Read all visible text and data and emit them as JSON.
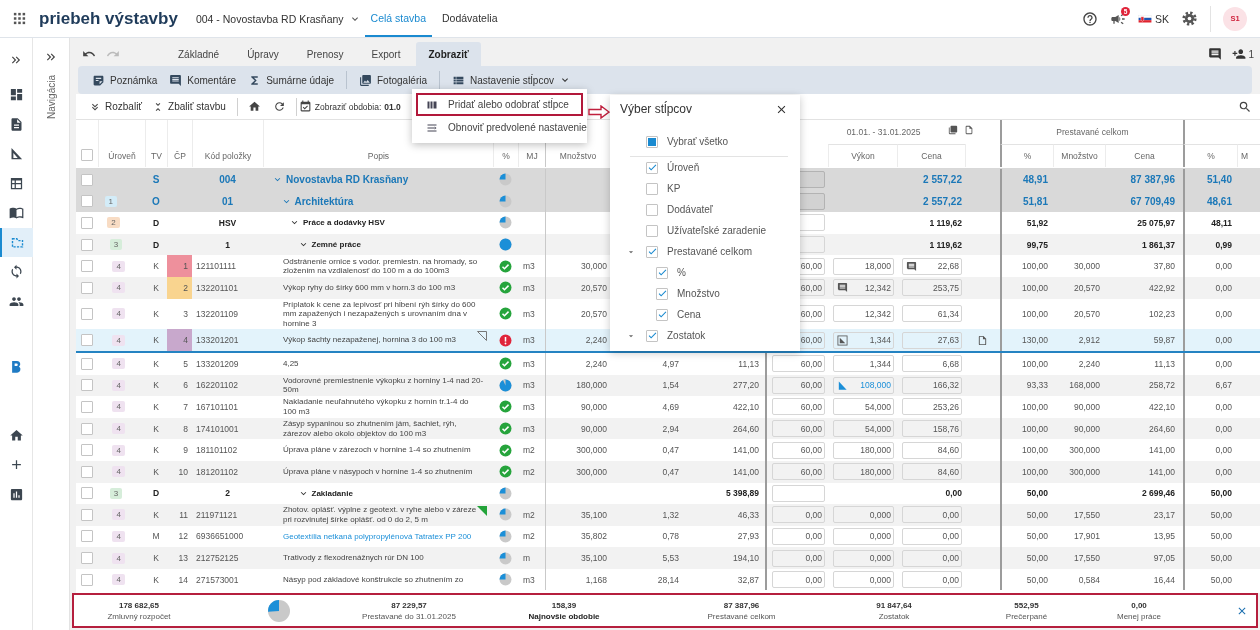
{
  "header": {
    "title": "priebeh výstavby",
    "project": "004 - Novostavba RD Krasňany",
    "tabs": [
      {
        "label": "Celá stavba",
        "selected": true
      },
      {
        "label": "Dodávatelia",
        "selected": false
      }
    ],
    "notifications": "5",
    "language": "SK",
    "avatar": "S1"
  },
  "rail": [
    {
      "selected": false
    },
    {
      "selected": false
    },
    {
      "selected": false
    },
    {
      "selected": false
    },
    {
      "selected": false
    },
    {
      "selected": true
    },
    {
      "selected": false
    },
    {
      "selected": false
    },
    {
      "selected": false
    },
    {
      "selected": false
    },
    {
      "selected": false
    },
    {
      "selected": false
    }
  ],
  "navigation": {
    "label": "Navigácia"
  },
  "toolbar": {
    "undo_enabled": true,
    "redo_enabled": false,
    "tabs": [
      {
        "label": "Základné",
        "selected": false
      },
      {
        "label": "Úpravy",
        "selected": false
      },
      {
        "label": "Prenosy",
        "selected": false
      },
      {
        "label": "Export",
        "selected": false
      },
      {
        "label": "Zobraziť",
        "selected": true
      }
    ],
    "online_users": "1"
  },
  "ribbon": {
    "groups": [
      [
        "Poznámka",
        "Komentáre",
        "Sumárne údaje"
      ],
      [
        "Fotogaléria"
      ]
    ],
    "columns_button": {
      "label": "Nastavenie stĺpcov",
      "expanded": true
    }
  },
  "columns_menu": {
    "items": [
      {
        "label": "Pridať alebo odobrať stĺpce",
        "highlighted": true
      },
      {
        "label": "Obnoviť predvolené nastavenie",
        "highlighted": false
      }
    ]
  },
  "actions": {
    "buttons": [
      "Rozbaliť",
      "Zbaliť stavbu"
    ],
    "period": "Zobraziť obdobia: **01.0**"
  },
  "column_picker": {
    "title": "Výber stĺpcov",
    "select_all": {
      "label": "Vybrať všetko",
      "checked": false,
      "indeterminate": true
    },
    "items": [
      {
        "label": "Úroveň",
        "checked": true
      },
      {
        "label": "KP",
        "checked": false
      },
      {
        "label": "Dodávateľ",
        "checked": false
      },
      {
        "label": "Užívateľské zaradenie",
        "checked": false
      },
      {
        "label": "Prestavané celkom",
        "checked": true,
        "expanded": true,
        "children": [
          {
            "label": "%",
            "checked": true
          },
          {
            "label": "Množstvo",
            "checked": true
          },
          {
            "label": "Cena",
            "checked": true
          }
        ]
      },
      {
        "label": "Zostatok",
        "checked": true,
        "expanded": true
      }
    ]
  },
  "table": {
    "header_checked": false,
    "period": "01.01. - 31.01.2025",
    "total_group": "Prestavané celkom",
    "headers": {
      "uroven": "Úroveň",
      "tv": "TV",
      "cp": "ČP",
      "code": "Kód položky",
      "desc": "Popis",
      "status": "%",
      "mj": "MJ",
      "qty": "Množstvo",
      "vykon": "Výkon",
      "cena": "Cena",
      "p_pct": "%",
      "p_qty": "Množstvo",
      "p_cena": "Cena",
      "z_pct": "%",
      "z_qty": "M"
    },
    "rows": [
      {
        "kind": "section",
        "selected": false,
        "checked": false,
        "tv": "S",
        "code": "004",
        "desc": "Novostavba RD Krasňany",
        "expanded": true,
        "status": {
          "kind": "pie",
          "level": 0.5
        },
        "cena": "2 557,22",
        "p_pct": "48,91",
        "p_cena": "87 387,96",
        "z_pct": "51,40",
        "children": [
          {
            "kind": "section",
            "selected": false,
            "checked": false,
            "uroven": {
              "text": "1",
              "color": "#d3ecf8"
            },
            "tv": "O",
            "code": "01",
            "desc": "Architektúra",
            "expanded": true,
            "status": {
              "kind": "pie",
              "level": 0.5
            },
            "cena": "2 557,22",
            "p_pct": "51,81",
            "p_cena": "67 709,49",
            "z_pct": "48,61",
            "children": [
              {
                "kind": "group",
                "selected": false,
                "checked": false,
                "uroven": {
                  "text": "2",
                  "color": "#f8dcc4"
                },
                "tv": "D",
                "code": "HSV",
                "desc": "Práce a dodávky HSV",
                "expanded": true,
                "status": {
                  "kind": "pie",
                  "level": 0.5
                },
                "cena": "1 119,62",
                "p_pct": "51,92",
                "p_cena": "25 075,97",
                "z_pct": "48,11",
                "children": [
                  {
                    "kind": "group",
                    "selected": false,
                    "checked": false,
                    "uroven": {
                      "text": "3",
                      "color": "#d6edda"
                    },
                    "tv": "D",
                    "code": "1",
                    "desc": "Zemné práce",
                    "expanded": true,
                    "status": {
                      "kind": "pie",
                      "level": 1
                    },
                    "cena": "1 119,62",
                    "p_pct": "99,75",
                    "p_cena": "1 861,37",
                    "z_pct": "0,99",
                    "children": [
                      {
                        "kind": "item",
                        "selected": false,
                        "checked": false,
                        "uroven": {
                          "text": "4",
                          "color": "#efe2f0"
                        },
                        "tv": "K",
                        "cp": {
                          "text": "1",
                          "color": "#ee909c"
                        },
                        "code": "121101111",
                        "desc": "Odstránenie ornice s vodor. premiestn. na hromady, so zložením na vzdialenosť do 100 m a do 100m3",
                        "status": {
                          "kind": "check"
                        },
                        "mj": "m3",
                        "qty": "30,000",
                        "pct": "60,00",
                        "vykon": "18,000",
                        "cena": "22,68",
                        "cena_icon": {
                          "kind": "comment"
                        },
                        "p_pct": "100,00",
                        "p_qty": "30,000",
                        "p_cena": "37,80",
                        "z_pct": "0,00"
                      },
                      {
                        "kind": "item",
                        "selected": false,
                        "checked": false,
                        "uroven": {
                          "text": "4",
                          "color": "#efe2f0"
                        },
                        "tv": "K",
                        "cp": {
                          "text": "2",
                          "color": "#f9d48f"
                        },
                        "code": "132201101",
                        "desc": "Výkop ryhy do šírky 600 mm v horn.3 do 100 m3",
                        "status": {
                          "kind": "check"
                        },
                        "mj": "m3",
                        "qty": "20,570",
                        "pct": "60,00",
                        "vykon": "12,342",
                        "vykon_icon": {
                          "kind": "comment",
                          "active": false
                        },
                        "cena": "253,75",
                        "p_pct": "100,00",
                        "p_qty": "20,570",
                        "p_cena": "422,92",
                        "z_pct": "0,00"
                      },
                      {
                        "kind": "item",
                        "selected": false,
                        "checked": false,
                        "uroven": {
                          "text": "4",
                          "color": "#efe2f0"
                        },
                        "tv": "K",
                        "cp": {
                          "text": "3"
                        },
                        "code": "132201109",
                        "desc": "Príplatok k cene za lepivosť pri hĺbení rýh šírky do 600 mm zapažených i nezapažených s urovnaním dna v hornine 3",
                        "status": {
                          "kind": "check"
                        },
                        "mj": "m3",
                        "qty": "20,570",
                        "pct": "60,00",
                        "vykon": "12,342",
                        "cena": "61,34",
                        "p_pct": "100,00",
                        "p_qty": "20,570",
                        "p_cena": "102,23",
                        "z_pct": "0,00"
                      },
                      {
                        "kind": "item",
                        "selected": true,
                        "checked": false,
                        "uroven": {
                          "text": "4",
                          "color": "#efe2f0"
                        },
                        "tv": "K",
                        "cp": {
                          "text": "4",
                          "color": "#c8a8cc"
                        },
                        "code": "133201201",
                        "desc": "Výkop šachty nezapaženej, hornina 3 do 100 m3",
                        "corner": {
                          "kind": "outline"
                        },
                        "status": {
                          "kind": "alert"
                        },
                        "mj": "m3",
                        "qty": "2,240",
                        "pct": "60,00",
                        "vykon": "1,344",
                        "vykon_icon": {
                          "kind": "sketch",
                          "active": false
                        },
                        "cena": "27,63",
                        "attachment": true,
                        "p_pct": "130,00",
                        "p_qty": "2,912",
                        "p_cena": "59,87",
                        "z_pct": "0,00"
                      },
                      {
                        "kind": "item",
                        "selected": false,
                        "checked": false,
                        "uroven": {
                          "text": "4",
                          "color": "#efe2f0"
                        },
                        "tv": "K",
                        "cp": {
                          "text": "5"
                        },
                        "code": "133201209",
                        "desc": "4,25",
                        "status": {
                          "kind": "check"
                        },
                        "mj": "m3",
                        "qty": "2,240",
                        "c9": "4,97",
                        "c10": "11,13",
                        "pct": "60,00",
                        "vykon": "1,344",
                        "cena": "6,68",
                        "p_pct": "100,00",
                        "p_qty": "2,240",
                        "p_cena": "11,13",
                        "z_pct": "0,00"
                      },
                      {
                        "kind": "item",
                        "selected": false,
                        "checked": false,
                        "uroven": {
                          "text": "4",
                          "color": "#efe2f0"
                        },
                        "tv": "K",
                        "cp": {
                          "text": "6"
                        },
                        "code": "162201102",
                        "desc": "Vodorovné premiestnenie výkopku z horniny 1-4 nad 20-50m",
                        "status": {
                          "kind": "pie",
                          "level": 0.93
                        },
                        "mj": "m3",
                        "qty": "180,000",
                        "c9": "1,54",
                        "c10": "277,20",
                        "pct": "60,00",
                        "vykon": "108,000",
                        "vykon_icon": {
                          "kind": "sketch",
                          "active": true
                        },
                        "cena": "166,32",
                        "p_pct": "93,33",
                        "p_qty": "168,000",
                        "p_cena": "258,72",
                        "z_pct": "6,67"
                      },
                      {
                        "kind": "item",
                        "selected": false,
                        "checked": false,
                        "uroven": {
                          "text": "4",
                          "color": "#efe2f0"
                        },
                        "tv": "K",
                        "cp": {
                          "text": "7"
                        },
                        "code": "167101101",
                        "desc": "Nakladanie neuľahnutého výkopku z hornín tr.1-4 do 100 m3",
                        "status": {
                          "kind": "check"
                        },
                        "mj": "m3",
                        "qty": "90,000",
                        "c9": "4,69",
                        "c10": "422,10",
                        "pct": "60,00",
                        "vykon": "54,000",
                        "cena": "253,26",
                        "p_pct": "100,00",
                        "p_qty": "90,000",
                        "p_cena": "422,10",
                        "z_pct": "0,00"
                      },
                      {
                        "kind": "item",
                        "selected": false,
                        "checked": false,
                        "uroven": {
                          "text": "4",
                          "color": "#efe2f0"
                        },
                        "tv": "K",
                        "cp": {
                          "text": "8"
                        },
                        "code": "174101001",
                        "desc": "Zásyp sypaninou so zhutnením jám, šachiet, rýh, zárezov alebo okolo objektov do 100 m3",
                        "status": {
                          "kind": "check"
                        },
                        "mj": "m3",
                        "qty": "90,000",
                        "c9": "2,94",
                        "c10": "264,60",
                        "pct": "60,00",
                        "vykon": "54,000",
                        "cena": "158,76",
                        "p_pct": "100,00",
                        "p_qty": "90,000",
                        "p_cena": "264,60",
                        "z_pct": "0,00"
                      },
                      {
                        "kind": "item",
                        "selected": false,
                        "checked": false,
                        "uroven": {
                          "text": "4",
                          "color": "#efe2f0"
                        },
                        "tv": "K",
                        "cp": {
                          "text": "9"
                        },
                        "code": "181101102",
                        "desc": "Úprava pláne v zárezoch v hornine 1-4 so zhutnením",
                        "status": {
                          "kind": "check"
                        },
                        "mj": "m2",
                        "qty": "300,000",
                        "c9": "0,47",
                        "c10": "141,00",
                        "pct": "60,00",
                        "vykon": "180,000",
                        "cena": "84,60",
                        "p_pct": "100,00",
                        "p_qty": "300,000",
                        "p_cena": "141,00",
                        "z_pct": "0,00"
                      },
                      {
                        "kind": "item",
                        "selected": false,
                        "checked": false,
                        "uroven": {
                          "text": "4",
                          "color": "#efe2f0"
                        },
                        "tv": "K",
                        "cp": {
                          "text": "10"
                        },
                        "code": "181201102",
                        "desc": "Úprava pláne v násypoch v hornine 1-4 so zhutnením",
                        "status": {
                          "kind": "check"
                        },
                        "mj": "m2",
                        "qty": "300,000",
                        "c9": "0,47",
                        "c10": "141,00",
                        "pct": "60,00",
                        "vykon": "180,000",
                        "cena": "84,60",
                        "p_pct": "100,00",
                        "p_qty": "300,000",
                        "p_cena": "141,00",
                        "z_pct": "0,00"
                      }
                    ]
                  },
                  {
                    "kind": "group",
                    "selected": false,
                    "checked": false,
                    "uroven": {
                      "text": "3",
                      "color": "#d6edda"
                    },
                    "tv": "D",
                    "code": "2",
                    "desc": "Zakladanie",
                    "expanded": true,
                    "status": {
                      "kind": "pie",
                      "level": 0.5
                    },
                    "c10": "5 398,89",
                    "cena": "0,00",
                    "p_pct": "50,00",
                    "p_cena": "2 699,46",
                    "z_pct": "50,00",
                    "children": [
                      {
                        "kind": "item",
                        "selected": false,
                        "checked": false,
                        "uroven": {
                          "text": "4",
                          "color": "#efe2f0"
                        },
                        "tv": "K",
                        "cp": {
                          "text": "11"
                        },
                        "code": "211971121",
                        "desc": "Zhotov. oplášť. výplne z geotext. v ryhe alebo v záreze pri rozvinutej šírke oplášť. od 0 do 2, 5 m",
                        "corner": {
                          "kind": "filled"
                        },
                        "status": {
                          "kind": "pie",
                          "level": 0.5
                        },
                        "mj": "m2",
                        "qty": "35,100",
                        "c9": "1,32",
                        "c10": "46,33",
                        "pct": "0,00",
                        "vykon": "0,000",
                        "cena": "0,00",
                        "p_pct": "50,00",
                        "p_qty": "17,550",
                        "p_cena": "23,17",
                        "z_pct": "50,00"
                      },
                      {
                        "kind": "item",
                        "selected": false,
                        "checked": false,
                        "uroven": {
                          "text": "4",
                          "color": "#efe2f0"
                        },
                        "tv": "M",
                        "cp": {
                          "text": "12"
                        },
                        "code": "6936651000",
                        "desc": "Geotextília netkaná polypropylénová Tatratex PP 200",
                        "link": true,
                        "status": {
                          "kind": "pie",
                          "level": 0.5
                        },
                        "mj": "m2",
                        "qty": "35,802",
                        "c9": "0,78",
                        "c10": "27,93",
                        "pct": "0,00",
                        "vykon": "0,000",
                        "cena": "0,00",
                        "p_pct": "50,00",
                        "p_qty": "17,901",
                        "p_cena": "13,95",
                        "z_pct": "50,00"
                      },
                      {
                        "kind": "item",
                        "selected": false,
                        "checked": false,
                        "uroven": {
                          "text": "4",
                          "color": "#efe2f0"
                        },
                        "tv": "K",
                        "cp": {
                          "text": "13"
                        },
                        "code": "212752125",
                        "desc": "Trativody z flexodrenážnych rúr DN 100",
                        "status": {
                          "kind": "pie",
                          "level": 0.5
                        },
                        "mj": "m",
                        "qty": "35,100",
                        "c9": "5,53",
                        "c10": "194,10",
                        "pct": "0,00",
                        "vykon": "0,000",
                        "cena": "0,00",
                        "p_pct": "50,00",
                        "p_qty": "17,550",
                        "p_cena": "97,05",
                        "z_pct": "50,00"
                      },
                      {
                        "kind": "item",
                        "selected": false,
                        "checked": false,
                        "uroven": {
                          "text": "4",
                          "color": "#efe2f0"
                        },
                        "tv": "K",
                        "cp": {
                          "text": "14"
                        },
                        "code": "271573001",
                        "desc": "Násyp pod základové konštrukcie so zhutnením zo",
                        "status": {
                          "kind": "pie",
                          "level": 0.5
                        },
                        "mj": "m3",
                        "qty": "1,168",
                        "c9": "28,14",
                        "c10": "32,87",
                        "pct": "0,00",
                        "vykon": "0,000",
                        "cena": "0,00",
                        "p_pct": "50,00",
                        "p_qty": "0,584",
                        "p_cena": "16,44",
                        "z_pct": "50,00"
                      }
                    ]
                  }
                ]
              }
            ]
          }
        ]
      }
    ]
  },
  "summary": {
    "level": 0.49,
    "items": [
      {
        "value": "178 682,65",
        "label": "Zmluvný rozpočet",
        "emphasis": false
      },
      {
        "value": "87 229,57",
        "label": "Prestavané do 31.01.2025",
        "emphasis": false
      },
      {
        "value": "158,39",
        "label": "Najnovšie obdobie",
        "emphasis": true
      },
      {
        "value": "87 387,96",
        "label": "Prestavané celkom",
        "emphasis": false
      },
      {
        "value": "91 847,64",
        "label": "Zostatok",
        "emphasis": false
      },
      {
        "value": "552,95",
        "label": "Prečerpané",
        "emphasis": false
      },
      {
        "value": "0,00",
        "label": "Menej práce",
        "emphasis": false
      }
    ]
  }
}
